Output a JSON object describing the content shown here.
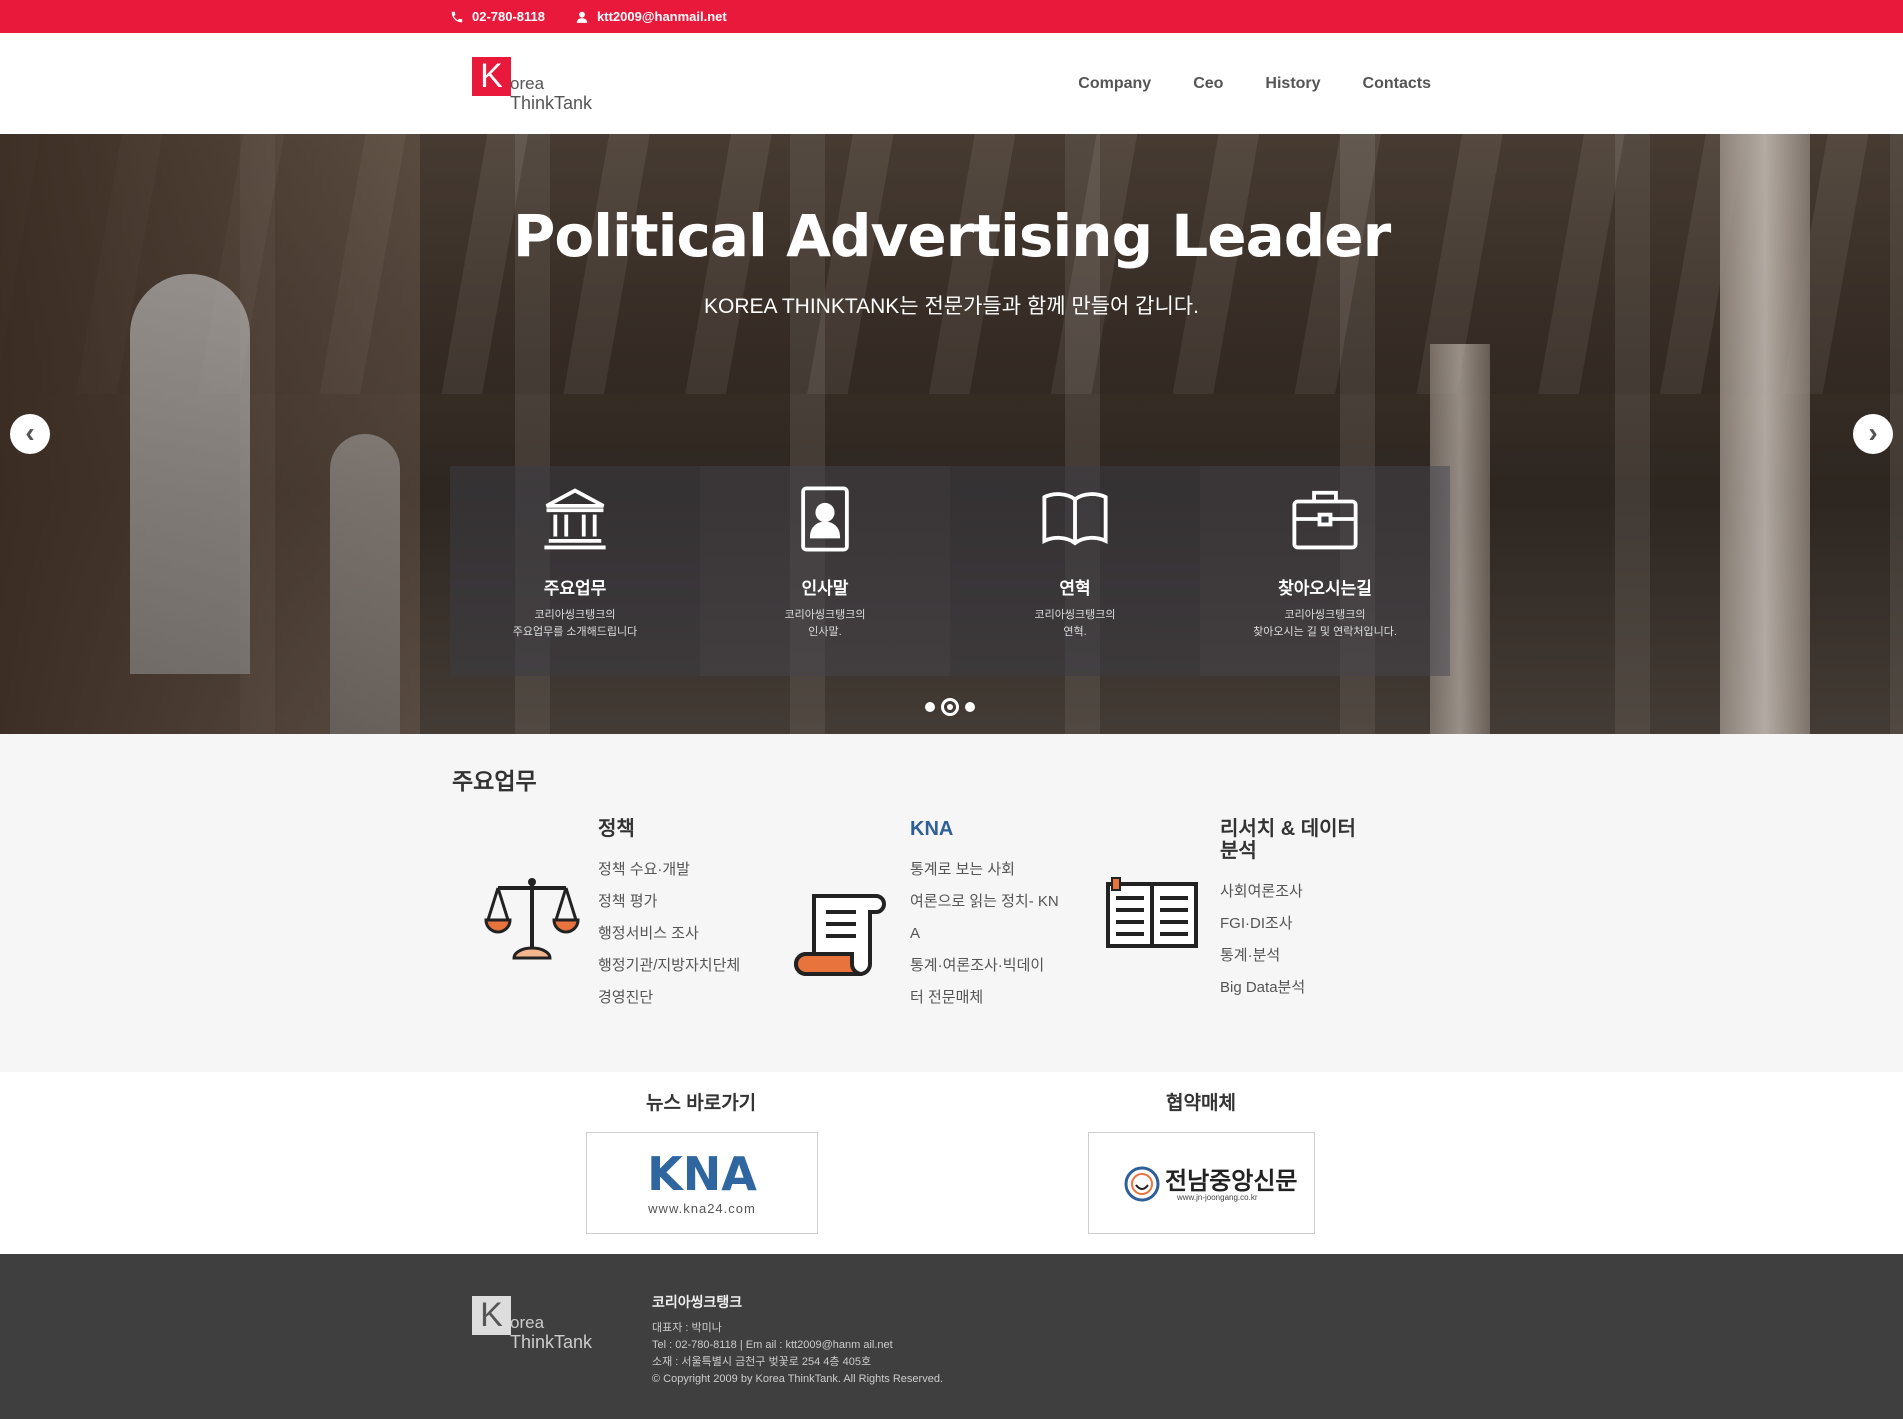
{
  "topbar": {
    "phone": "02-780-8118",
    "email": "ktt2009@hanmail.net",
    "accent_color": "#e8193b"
  },
  "logo": {
    "k": "K",
    "line1": "orea",
    "line2": "ThinkTank"
  },
  "nav": {
    "items": [
      "Company",
      "Ceo",
      "History",
      "Contacts"
    ]
  },
  "hero": {
    "title": "Political Advertising Leader",
    "subtitle": "KOREA THINKTANK는 전문가들과 함께 만들어 갑니다.",
    "slide_count": 3,
    "active_slide": 2,
    "boxes": [
      {
        "icon": "bank-icon",
        "title": "주요업무",
        "desc1": "코리아씽크탱크의",
        "desc2": "주요업무를 소개해드립니다"
      },
      {
        "icon": "id-card-icon",
        "title": "인사말",
        "desc1": "코리아씽크탱크의",
        "desc2": "인사말."
      },
      {
        "icon": "open-book-icon",
        "title": "연혁",
        "desc1": "코리아씽크탱크의",
        "desc2": "연혁."
      },
      {
        "icon": "briefcase-icon",
        "title": "찾아오시는길",
        "desc1": "코리아씽크탱크의",
        "desc2": "찾아오시는 길 및 연락처입니다."
      }
    ]
  },
  "services": {
    "heading": "주요업무",
    "columns": [
      {
        "title": "정책",
        "items": [
          "정책 수요·개발",
          "정책 평가",
          "행정서비스 조사",
          "행정기관/지방자치단체",
          "경영진단"
        ]
      },
      {
        "title": "KNA",
        "items": [
          "통계로 보는 사회",
          "여론으로 읽는 정치- KN",
          "A",
          "통계·여론조사·빅데이",
          "터 전문매체"
        ]
      },
      {
        "title_line1": "리서치 & 데이터",
        "title_line2": "분석",
        "items": [
          "사회여론조사",
          "FGI·DI조사",
          "통계·분석",
          "Big Data분석"
        ]
      }
    ]
  },
  "links": {
    "news_title": "뉴스 바로가기",
    "partner_title": "협약매체",
    "kna_logo": "KNA",
    "kna_url": "www.kna24.com",
    "jn_name": "전남중앙신문",
    "jn_url": "www.jn-joongang.co.kr"
  },
  "footer": {
    "company": "코리아씽크탱크",
    "rep": "대표자 : 박미나",
    "contact": "Tel : 02-780-8118    |    Em ail : ktt2009@hanm ail.net",
    "address": "소재 : 서울특별시 금천구 벚꽃로 254 4층 405호",
    "copyright": "© Copyright 2009 by Korea ThinkTank. All Rights Reserved."
  }
}
